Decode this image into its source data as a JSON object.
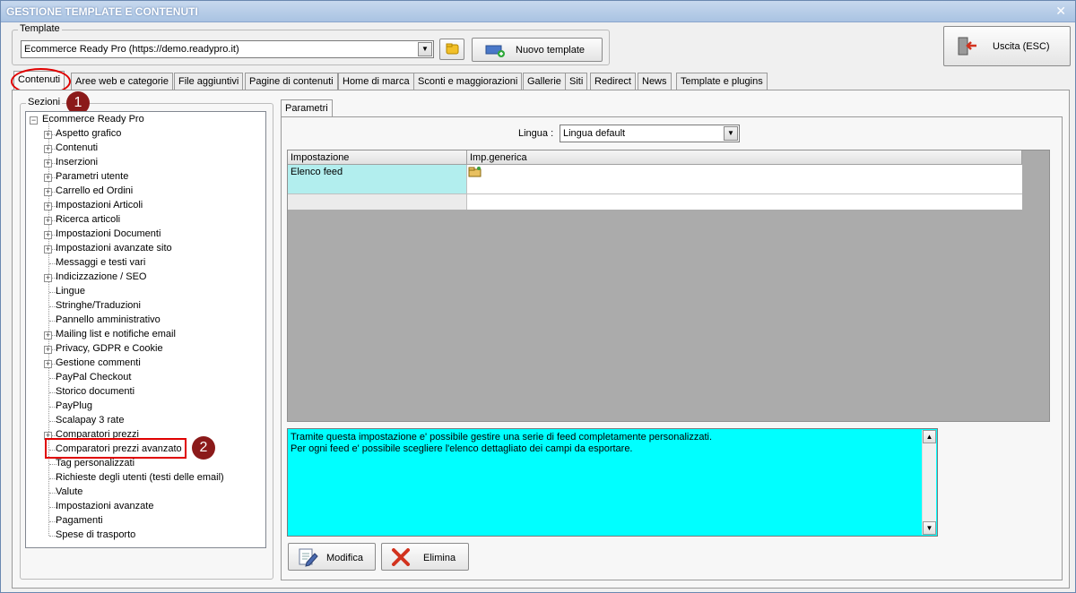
{
  "window": {
    "title": "GESTIONE TEMPLATE E CONTENUTI",
    "close_label": "✕"
  },
  "template_group": {
    "legend": "Template",
    "selected": "Ecommerce Ready Pro (https://demo.readypro.it)",
    "new_button": "Nuovo template"
  },
  "exit_button": "Uscita (ESC)",
  "tabs": [
    "Contenuti",
    "Aree web e categorie",
    "File aggiuntivi",
    "Pagine di contenuti",
    "Home di marca",
    "Sconti e maggiorazioni",
    "Gallerie",
    "Siti",
    "Redirect",
    "News",
    "Template e plugins"
  ],
  "sections": {
    "legend": "Sezioni",
    "root": "Ecommerce Ready Pro",
    "items": [
      {
        "label": "Aspetto grafico",
        "expandable": true
      },
      {
        "label": "Contenuti",
        "expandable": true
      },
      {
        "label": "Inserzioni",
        "expandable": true
      },
      {
        "label": "Parametri utente",
        "expandable": true
      },
      {
        "label": "Carrello ed Ordini",
        "expandable": true
      },
      {
        "label": "Impostazioni Articoli",
        "expandable": true
      },
      {
        "label": "Ricerca articoli",
        "expandable": true
      },
      {
        "label": "Impostazioni Documenti",
        "expandable": true
      },
      {
        "label": "Impostazioni avanzate sito",
        "expandable": true
      },
      {
        "label": "Messaggi e testi vari",
        "expandable": false
      },
      {
        "label": "Indicizzazione / SEO",
        "expandable": true
      },
      {
        "label": "Lingue",
        "expandable": false
      },
      {
        "label": "Stringhe/Traduzioni",
        "expandable": false
      },
      {
        "label": "Pannello amministrativo",
        "expandable": false
      },
      {
        "label": "Mailing list e notifiche email",
        "expandable": true
      },
      {
        "label": "Privacy, GDPR e Cookie",
        "expandable": true
      },
      {
        "label": "Gestione commenti",
        "expandable": true
      },
      {
        "label": "PayPal Checkout",
        "expandable": false
      },
      {
        "label": "Storico documenti",
        "expandable": false
      },
      {
        "label": "PayPlug",
        "expandable": false
      },
      {
        "label": "Scalapay 3 rate",
        "expandable": false
      },
      {
        "label": "Comparatori prezzi",
        "expandable": true
      },
      {
        "label": "Comparatori prezzi avanzato",
        "expandable": false
      },
      {
        "label": "Tag personalizzati",
        "expandable": false
      },
      {
        "label": "Richieste degli utenti (testi delle email)",
        "expandable": false
      },
      {
        "label": "Valute",
        "expandable": false
      },
      {
        "label": "Impostazioni avanzate",
        "expandable": false
      },
      {
        "label": "Pagamenti",
        "expandable": false
      },
      {
        "label": "Spese di trasporto",
        "expandable": false
      }
    ]
  },
  "badges": {
    "one": "1",
    "two": "2"
  },
  "params_tab": "Parametri",
  "lingua": {
    "label": "Lingua :",
    "selected": "Lingua default"
  },
  "grid": {
    "headers": [
      "Impostazione",
      "Imp.generica"
    ],
    "rows": [
      [
        "Elenco feed",
        ""
      ]
    ]
  },
  "description": {
    "line1": "Tramite questa impostazione e' possibile gestire una serie di feed completamente personalizzati.",
    "line2": "Per ogni feed e' possibile scegliere l'elenco dettagliato dei campi da esportare."
  },
  "buttons": {
    "edit": "Modifica",
    "delete": "Elimina"
  },
  "colors": {
    "highlight": "#00ffff",
    "row_selected": "#b2eeee",
    "annotation": "#e00000",
    "badge": "#8b1a1a"
  }
}
